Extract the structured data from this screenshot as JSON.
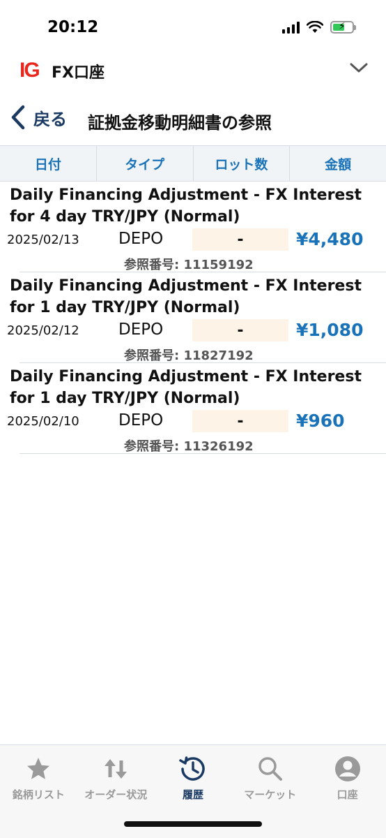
{
  "status": {
    "time": "20:12"
  },
  "account": {
    "logo": "IG",
    "title": "FX口座",
    "chevron_icon": "chevron-down-icon"
  },
  "nav": {
    "back_label": "戻る",
    "title": "証拠金移動明細書の参照"
  },
  "table": {
    "columns": [
      "日付",
      "タイプ",
      "ロット数",
      "金額"
    ],
    "rows": [
      {
        "description": "Daily Financing Adjustment - FX Interest for 4 day TRY/JPY (Normal)",
        "date": "2025/02/13",
        "type": "DEPO",
        "lot": "-",
        "amount": "¥4,480",
        "reference": "参照番号: 11159192"
      },
      {
        "description": "Daily Financing Adjustment - FX Interest for 1 day TRY/JPY (Normal)",
        "date": "2025/02/12",
        "type": "DEPO",
        "lot": "-",
        "amount": "¥1,080",
        "reference": "参照番号: 11827192"
      },
      {
        "description": "Daily Financing Adjustment - FX Interest for 1 day TRY/JPY (Normal)",
        "date": "2025/02/10",
        "type": "DEPO",
        "lot": "-",
        "amount": "¥960",
        "reference": "参照番号: 11326192"
      }
    ]
  },
  "tabs": [
    {
      "label": "銘柄リスト",
      "icon": "star-icon",
      "active": false
    },
    {
      "label": "オーダー状況",
      "icon": "up-down-arrows-icon",
      "active": false
    },
    {
      "label": "履歴",
      "icon": "history-clock-icon",
      "active": true
    },
    {
      "label": "マーケット",
      "icon": "search-icon",
      "active": false
    },
    {
      "label": "口座",
      "icon": "account-user-icon",
      "active": false
    }
  ],
  "colors": {
    "accent": "#1a73b8",
    "nav": "#1a3a63",
    "brand": "#e8281e",
    "lot_bg": "#fdf3e6",
    "header_bg": "#f1f4f7"
  }
}
